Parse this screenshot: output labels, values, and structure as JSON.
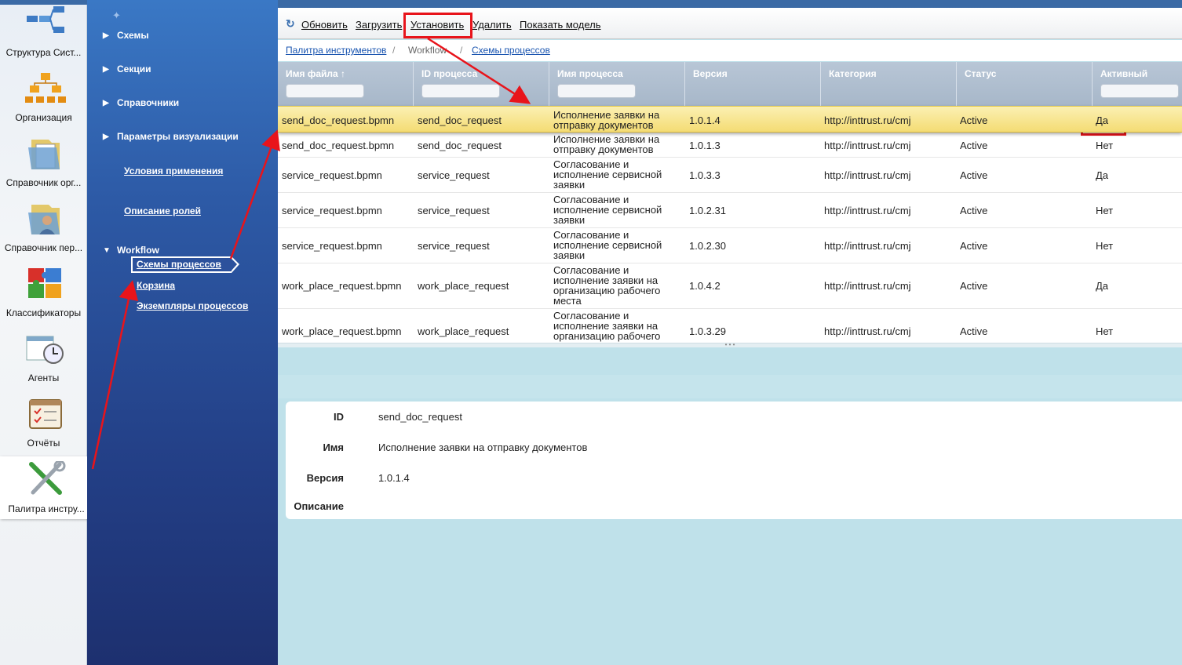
{
  "appbar": {
    "items": [
      {
        "label": "Структура Сист...",
        "icon": "structure-icon"
      },
      {
        "label": "Организация",
        "icon": "org-chart-icon"
      },
      {
        "label": "Справочник орг...",
        "icon": "folder-icon"
      },
      {
        "label": "Справочник пер...",
        "icon": "people-folder-icon"
      },
      {
        "label": "Классификаторы",
        "icon": "puzzle-icon"
      },
      {
        "label": "Агенты",
        "icon": "clock-calendar-icon"
      },
      {
        "label": "Отчёты",
        "icon": "checklist-icon"
      },
      {
        "label": "Палитра инстру...",
        "icon": "tools-icon"
      }
    ]
  },
  "nav": {
    "sections": {
      "schemes": "Схемы",
      "sections": "Секции",
      "dictionaries": "Справочники",
      "visualization": "Параметры визуализации",
      "workflow": "Workflow"
    },
    "links": {
      "conditions": "Условия применения",
      "roles": "Описание ролей"
    },
    "workflow_items": {
      "schemes": "Схемы процессов",
      "trash": "Корзина",
      "instances": "Экземпляры процессов"
    }
  },
  "toolbar": {
    "refresh": "Обновить",
    "upload": "Загрузить",
    "install": "Установить",
    "delete": "Удалить",
    "show_model": "Показать модель"
  },
  "breadcrumbs": {
    "first": "Палитра инструментов",
    "sep": "/",
    "second": "Workflow",
    "third": "Схемы процессов"
  },
  "grid": {
    "columns": {
      "file": "Имя файла ↑",
      "pid": "ID процесса",
      "pname": "Имя процесса",
      "version": "Версия",
      "category": "Категория",
      "status": "Статус",
      "active": "Активный"
    },
    "rows": [
      {
        "file": "send_doc_request.bpmn",
        "pid": "send_doc_request",
        "pname": "Исполнение заявки на отправку документов",
        "version": "1.0.1.4",
        "category": "http://inttrust.ru/cmj",
        "status": "Active",
        "active": "Да"
      },
      {
        "file": "send_doc_request.bpmn",
        "pid": "send_doc_request",
        "pname": "Исполнение заявки на отправку документов",
        "version": "1.0.1.3",
        "category": "http://inttrust.ru/cmj",
        "status": "Active",
        "active": "Нет"
      },
      {
        "file": "service_request.bpmn",
        "pid": "service_request",
        "pname": "Согласование и исполнение сервисной заявки",
        "version": "1.0.3.3",
        "category": "http://inttrust.ru/cmj",
        "status": "Active",
        "active": "Да"
      },
      {
        "file": "service_request.bpmn",
        "pid": "service_request",
        "pname": "Согласование и исполнение сервисной заявки",
        "version": "1.0.2.31",
        "category": "http://inttrust.ru/cmj",
        "status": "Active",
        "active": "Нет"
      },
      {
        "file": "service_request.bpmn",
        "pid": "service_request",
        "pname": "Согласование и исполнение сервисной заявки",
        "version": "1.0.2.30",
        "category": "http://inttrust.ru/cmj",
        "status": "Active",
        "active": "Нет"
      },
      {
        "file": "work_place_request.bpmn",
        "pid": "work_place_request",
        "pname": "Согласование и исполнение заявки на организацию рабочего места",
        "version": "1.0.4.2",
        "category": "http://inttrust.ru/cmj",
        "status": "Active",
        "active": "Да"
      },
      {
        "file": "work_place_request.bpmn",
        "pid": "work_place_request",
        "pname": "Согласование и исполнение заявки на организацию рабочего",
        "version": "1.0.3.29",
        "category": "http://inttrust.ru/cmj",
        "status": "Active",
        "active": "Нет"
      }
    ]
  },
  "detail": {
    "id_label": "ID",
    "id_value": "send_doc_request",
    "name_label": "Имя",
    "name_value": "Исполнение заявки на отправку документов",
    "version_label": "Версия",
    "version_value": "1.0.1.4",
    "description_label": "Описание"
  },
  "colors": {
    "nav_blue": "#2d5aa6",
    "selected_row": "#f4dc74",
    "annotation_red": "#e8141b",
    "detail_bg": "#bfe1ea"
  }
}
